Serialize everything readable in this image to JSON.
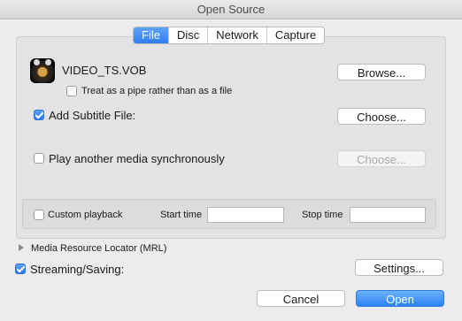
{
  "window": {
    "title": "Open Source"
  },
  "tabs": [
    {
      "label": "File",
      "active": true
    },
    {
      "label": "Disc",
      "active": false
    },
    {
      "label": "Network",
      "active": false
    },
    {
      "label": "Capture",
      "active": false
    }
  ],
  "file": {
    "name": "VIDEO_TS.VOB",
    "icon": "vlc-media-file-icon",
    "pipe_label": "Treat as a pipe rather than as a file",
    "pipe_checked": false,
    "browse_label": "Browse..."
  },
  "subtitle": {
    "label": "Add Subtitle File:",
    "checked": true,
    "button": "Choose..."
  },
  "sync": {
    "label": "Play another media synchronously",
    "checked": false,
    "button": "Choose...",
    "button_enabled": false
  },
  "custom": {
    "label": "Custom playback",
    "checked": false,
    "start_label": "Start time",
    "start_value": "",
    "stop_label": "Stop time",
    "stop_value": ""
  },
  "mrl": {
    "label": "Media Resource Locator (MRL)",
    "icon": "disclosure-triangle-icon"
  },
  "streaming": {
    "label": "Streaming/Saving:",
    "checked": true,
    "button": "Settings..."
  },
  "actions": {
    "cancel": "Cancel",
    "open": "Open"
  },
  "colors": {
    "accent": "#2f7ef1",
    "background": "#ececec"
  }
}
